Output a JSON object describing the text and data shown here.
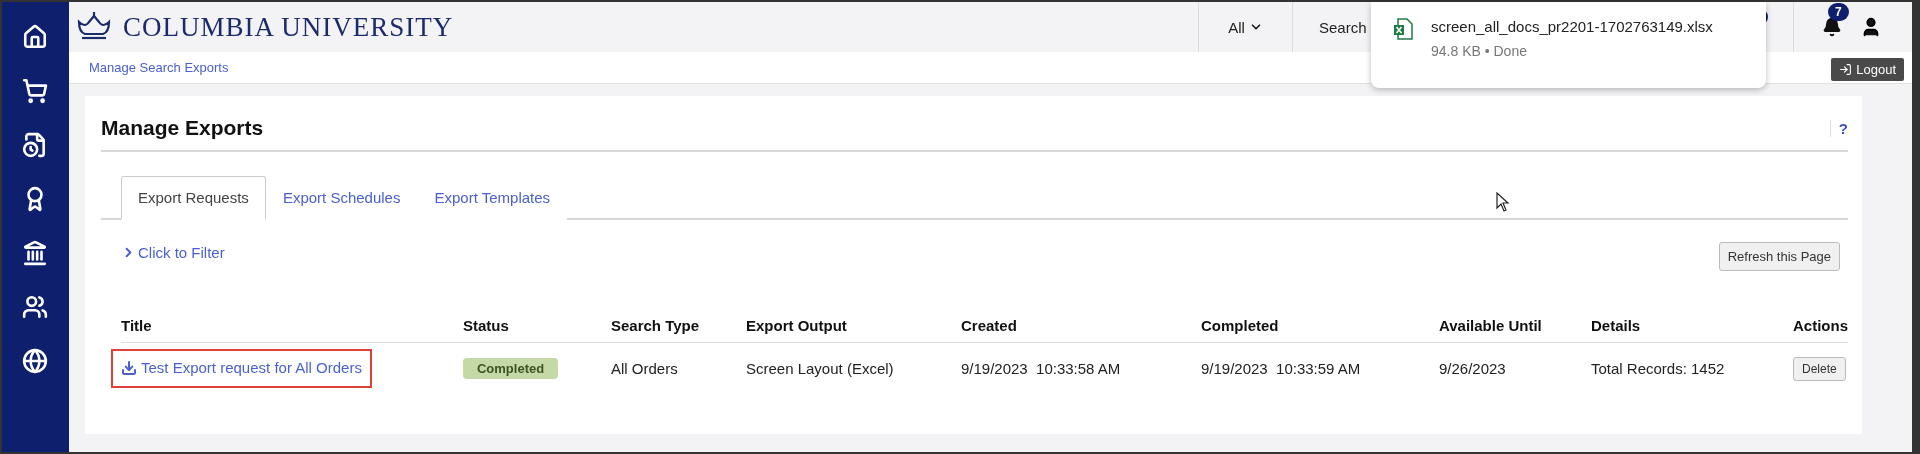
{
  "header": {
    "logo": "COLUMBIA UNIVERSITY",
    "scope_dropdown": "All",
    "search": "Search",
    "notifications_count": "7"
  },
  "breadcrumb": "Manage Search Exports",
  "logout": "Logout",
  "download_popup": {
    "filename": "screen_all_docs_pr2201-1702763149.xlsx",
    "details": "94.8 KB • Done"
  },
  "page": {
    "title": "Manage Exports",
    "help": "?",
    "filter": "Click to Filter",
    "refresh": "Refresh this Page",
    "tabs": [
      {
        "label": "Export Requests",
        "selected": true
      },
      {
        "label": "Export Schedules",
        "selected": false
      },
      {
        "label": "Export Templates",
        "selected": false
      }
    ]
  },
  "table": {
    "columns": [
      "Title",
      "Status",
      "Search Type",
      "Export Output",
      "Created",
      "Completed",
      "Available Until",
      "Details",
      "Actions"
    ],
    "rows": [
      {
        "title": "Test Export request for All Orders",
        "status": "Completed",
        "search_type": "All Orders",
        "export_output": "Screen Layout (Excel)",
        "created": "9/19/2023  10:33:58 AM",
        "completed": "9/19/2023  10:33:59 AM",
        "available_until": "9/26/2023",
        "details": "Total Records: 1452",
        "action": "Delete",
        "highlighted": true
      }
    ]
  }
}
